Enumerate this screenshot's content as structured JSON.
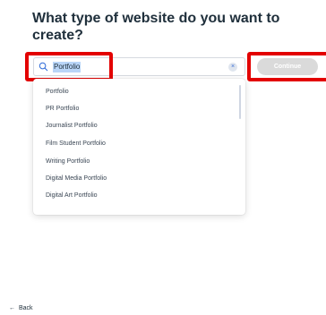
{
  "page": {
    "heading": "What type of website do you want to create?"
  },
  "search": {
    "value": "Portfolio",
    "clear_symbol": "×",
    "icon": "search-icon"
  },
  "continue_button": {
    "label": "Continue",
    "enabled": false
  },
  "dropdown": {
    "options": [
      "Portfolio",
      "PR Portfolio",
      "Journalist Portfolio",
      "Film Student Portfolio",
      "Writing Portfolio",
      "Digital Media Portfolio",
      "Digital Art Portfolio"
    ]
  },
  "footer": {
    "back_label": "Back",
    "back_arrow": "←"
  },
  "colors": {
    "highlight": "#e30000",
    "selection": "#b9d5f7",
    "continue_disabled": "#dadada"
  }
}
